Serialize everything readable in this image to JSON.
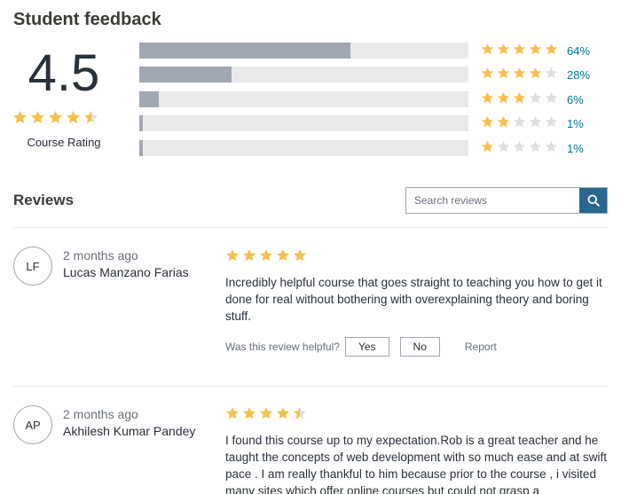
{
  "header": {
    "title": "Student feedback"
  },
  "summary": {
    "rating": "4.5",
    "rating_value": 4.5,
    "label": "Course Rating",
    "breakdown": [
      {
        "stars": 5,
        "percent_label": "64%",
        "percent": 64
      },
      {
        "stars": 4,
        "percent_label": "28%",
        "percent": 28
      },
      {
        "stars": 3,
        "percent_label": "6%",
        "percent": 6
      },
      {
        "stars": 2,
        "percent_label": "1%",
        "percent": 1
      },
      {
        "stars": 1,
        "percent_label": "1%",
        "percent": 1
      }
    ]
  },
  "reviews_section": {
    "title": "Reviews",
    "search_placeholder": "Search reviews",
    "search_icon": "search-icon"
  },
  "reviews": [
    {
      "initials": "LF",
      "date": "2 months ago",
      "name": "Lucas Manzano Farias",
      "rating": 5,
      "text": "Incredibly helpful course that goes straight to teaching you how to get it done for real without bothering with overexplaining theory and boring stuff.",
      "helpful_prompt": "Was this review helpful?",
      "yes_label": "Yes",
      "no_label": "No",
      "report_label": "Report"
    },
    {
      "initials": "AP",
      "date": "2 months ago",
      "name": "Akhilesh Kumar Pandey",
      "rating": 4.5,
      "text": "I found this course up to my expectation.Rob is a great teacher and he taught the concepts of web development with so much ease and at swift pace . I am really thankful to him because prior to the course , i visited many sites which offer online courses but could not grasp a"
    }
  ],
  "colors": {
    "star_filled": "#f4c150",
    "star_empty": "#dedfe0",
    "bar_fill": "#a1a7b3",
    "bar_track": "#e8e9eb",
    "link": "#007791",
    "search_button": "#29678e"
  }
}
